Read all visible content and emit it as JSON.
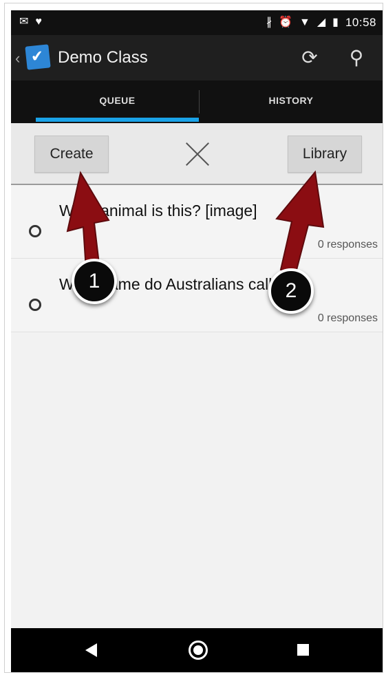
{
  "status_bar": {
    "left_icons": [
      "mail-icon",
      "heart-icon"
    ],
    "right_icons": [
      "bluetooth-icon",
      "alarm-icon",
      "wifi-icon",
      "signal-icon",
      "battery-icon"
    ],
    "time": "10:58"
  },
  "action_bar": {
    "title": "Demo Class",
    "icons": [
      "sync-icon",
      "search-icon"
    ]
  },
  "tabs": [
    {
      "label": "QUEUE",
      "selected": true
    },
    {
      "label": "HISTORY",
      "selected": false
    }
  ],
  "toolbar": {
    "create_label": "Create",
    "library_label": "Library"
  },
  "questions": [
    {
      "text": "What animal is this? [image]",
      "responses": "0 responses"
    },
    {
      "text": "What name do Australians call A..",
      "responses": "0 responses"
    }
  ],
  "annotations": [
    {
      "number": "1"
    },
    {
      "number": "2"
    }
  ],
  "colors": {
    "accent": "#1aa3e8",
    "arrow": "#8b0d12",
    "badge": "#0a0a0a"
  }
}
